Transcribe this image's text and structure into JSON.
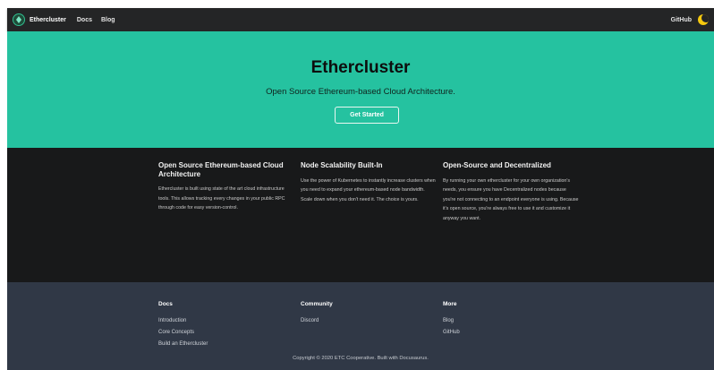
{
  "navbar": {
    "brand": "Ethercluster",
    "links": [
      "Docs",
      "Blog"
    ],
    "github": "GitHub",
    "theme_toggle_icon": "moon-icon"
  },
  "hero": {
    "title": "Ethercluster",
    "tagline": "Open Source Ethereum-based Cloud Architecture.",
    "button": "Get Started"
  },
  "features": [
    {
      "title": "Open Source Ethereum-based Cloud Architecture",
      "text": "Ethercluster is built using state of the art cloud infrastructure tools. This allows tracking every changes in your public RPC through code for easy version-control."
    },
    {
      "title": "Node Scalability Built-In",
      "text": "Use the power of Kubernetes to instantly increase clusters when you need to expand your ethereum-based node bandwidth. Scale down when you don't need it. The choice is yours."
    },
    {
      "title": "Open-Source and Decentralized",
      "text": "By running your own ethercluster for your own organization's needs, you ensure you have Decentralized nodes because you're not connecting to an endpoint everyone is using. Because it's open source, you're always free to use it and customize it anyway you want."
    }
  ],
  "footer": {
    "columns": [
      {
        "title": "Docs",
        "links": [
          "Introduction",
          "Core Concepts",
          "Build an Ethercluster"
        ]
      },
      {
        "title": "Community",
        "links": [
          "Discord"
        ]
      },
      {
        "title": "More",
        "links": [
          "Blog",
          "GitHub"
        ]
      }
    ],
    "copyright": "Copyright © 2020 ETC Cooperative. Built with Docusaurus."
  },
  "colors": {
    "primary": "#25c2a0",
    "navbar": "#242526",
    "background": "#18191a",
    "footer": "#303846"
  }
}
